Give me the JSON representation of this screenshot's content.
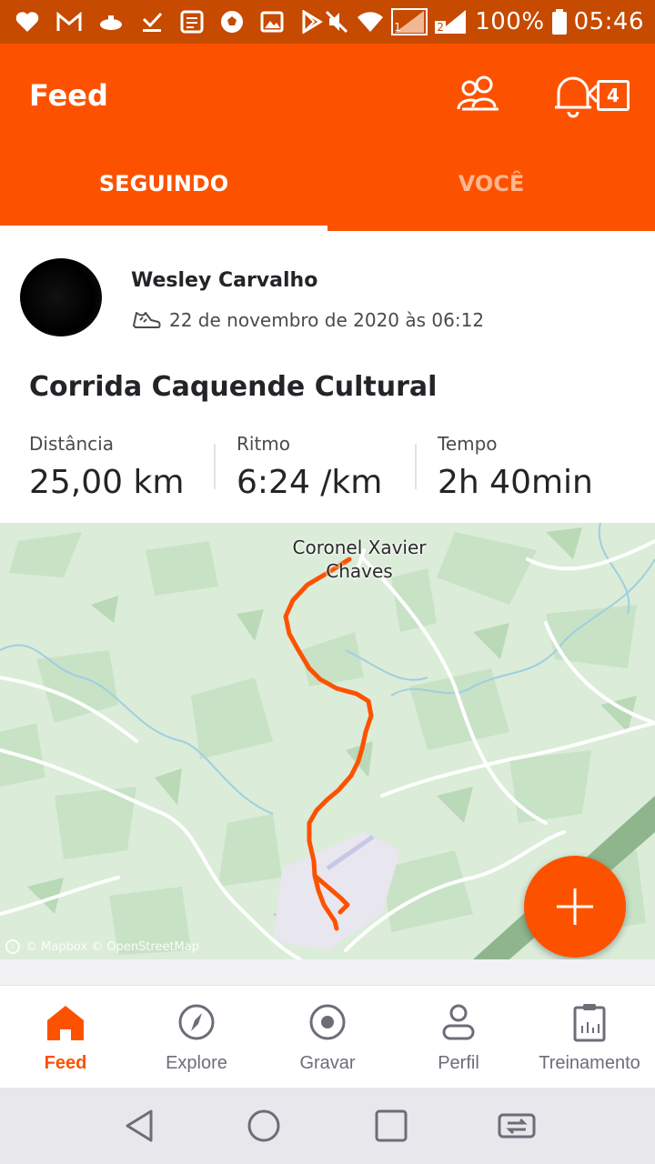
{
  "status_bar": {
    "battery": "100%",
    "time": "05:46",
    "sim1": "1",
    "sim2": "2"
  },
  "header": {
    "title": "Feed",
    "notification_count": "4",
    "tabs": [
      {
        "label": "SEGUINDO",
        "active": true
      },
      {
        "label": "VOCÊ",
        "active": false
      }
    ]
  },
  "activity": {
    "athlete_name": "Wesley Carvalho",
    "activity_type_icon": "shoe-icon",
    "date": "22 de novembro de 2020 às 06:12",
    "title": "Corrida Caquende Cultural",
    "stats": [
      {
        "label": "Distância",
        "value": "25,00 km"
      },
      {
        "label": "Ritmo",
        "value": "6:24 /km"
      },
      {
        "label": "Tempo",
        "value": "2h 40min"
      }
    ]
  },
  "map": {
    "place_label": "Coronel Xavier Chaves",
    "attribution": "© Mapbox © OpenStreetMap",
    "route_color": "#fc5200"
  },
  "bottom_nav": {
    "items": [
      {
        "label": "Feed",
        "icon": "home-icon",
        "active": true
      },
      {
        "label": "Explore",
        "icon": "compass-icon",
        "active": false
      },
      {
        "label": "Gravar",
        "icon": "record-icon",
        "active": false
      },
      {
        "label": "Perfil",
        "icon": "profile-icon",
        "active": false
      },
      {
        "label": "Treinamento",
        "icon": "training-icon",
        "active": false
      }
    ]
  },
  "colors": {
    "brand": "#fc5200",
    "status_bar": "#c64a00"
  }
}
